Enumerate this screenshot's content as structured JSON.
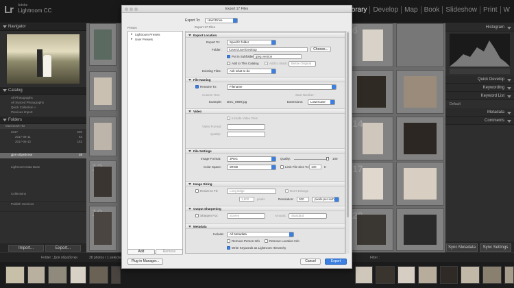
{
  "app": {
    "logo": "Lr",
    "vendor": "Adobe",
    "name": "Lightroom CC"
  },
  "modules": [
    "Library",
    "Develop",
    "Map",
    "Book",
    "Slideshow",
    "Print",
    "W"
  ],
  "left_panel": {
    "navigator": "Navigator",
    "catalog": "Catalog",
    "catalog_items": [
      "All Photographs",
      "All Synced Photographs",
      "Quick Collection +",
      "Previous Import"
    ],
    "folders": "Folders",
    "volume": "Macintosh HD",
    "folder_items": [
      {
        "label": "2017",
        "count": "230"
      },
      {
        "label": "2017-06-11",
        "count": "63"
      },
      {
        "label": "2017-06-12",
        "count": "162"
      }
    ],
    "selected_folder": {
      "label": "Для обработки",
      "count": "38"
    },
    "folder2": "Lightroom Data Base",
    "collections": [
      "Collections",
      "Publish Services"
    ],
    "import_btn": "Import...",
    "export_btn": "Export..."
  },
  "right_panel": {
    "histogram": "Histogram",
    "quick_develop": "Quick Develop",
    "keywording": "Keywording",
    "keyword_list": "Keyword List",
    "metadata": "Metadata",
    "comments": "Comments",
    "default": "Default",
    "sync_metadata": "Sync Metadata",
    "sync_settings": "Sync Settings"
  },
  "grid": {
    "numbers": [
      "6",
      "13",
      "14",
      "17",
      "19",
      "20"
    ]
  },
  "filmstrip": {
    "path": "Folder : Для обработки",
    "info": "38 photos / 1 selected / DSC_0999.jpg",
    "filter": "Filter :"
  },
  "dialog": {
    "title": "Export 17 Files",
    "export_to_label": "Export To:",
    "export_to_value": "Hard Drive",
    "subtitle": "Export 17 Files",
    "preset_header": "Preset:",
    "presets": [
      "Lightroom Presets",
      "User Presets"
    ],
    "add_btn": "Add",
    "remove_btn": "Remove",
    "sections": {
      "location": "Export Location",
      "naming": "File Naming",
      "video": "Video",
      "settings": "File Settings",
      "sizing": "Image Sizing",
      "sharpening": "Output Sharpening",
      "metadata": "Metadata"
    },
    "location": {
      "export_to": "Export To:",
      "export_to_value": "Specific folder",
      "folder": "Folder:",
      "folder_value": "/Users/user/Desktop",
      "choose": "Choose...",
      "subfolder": "Put in Subfolder:",
      "subfolder_value": "jpeg version",
      "add_catalog": "Add to This Catalog",
      "add_stack": "Add to Stack:",
      "below": "Below Original",
      "existing": "Existing Files:",
      "existing_value": "Ask what to do"
    },
    "naming": {
      "rename": "Rename To:",
      "rename_value": "Filename",
      "custom": "Custom Text:",
      "start": "Start Number:",
      "example_label": "Example:",
      "example": "DSC_0999.jpg",
      "extensions": "Extensions:",
      "ext_value": "Lowercase"
    },
    "video": {
      "include": "Include Video Files",
      "format": "Video Format:",
      "quality": "Quality:"
    },
    "settings": {
      "format": "Image Format:",
      "format_value": "JPEG",
      "quality": "Quality:",
      "quality_value": "100",
      "colorspace": "Color Space:",
      "colorspace_value": "sRGB",
      "limit": "Limit File Size To:",
      "limit_value": "100",
      "limit_unit": "K"
    },
    "sizing": {
      "resize": "Resize to Fit:",
      "resize_value": "Long Edge",
      "enlarge": "Don't Enlarge",
      "size_value": "1,800",
      "size_unit": "pixels",
      "resolution": "Resolution:",
      "resolution_value": "300",
      "res_unit": "pixels per inch"
    },
    "sharpening": {
      "sharpen": "Sharpen For:",
      "sharpen_value": "Screen",
      "amount": "Amount:",
      "amount_value": "Standard"
    },
    "metadata": {
      "include": "Include:",
      "include_value": "All Metadata",
      "remove_person": "Remove Person Info",
      "remove_location": "Remove Location Info",
      "keywords": "Write Keywords as Lightroom Hierarchy"
    },
    "plugin_btn": "Plug-in Manager...",
    "cancel_btn": "Cancel",
    "export_btn": "Export"
  },
  "colors": {
    "accent": "#3b7fe0",
    "panel": "#2e2e2e",
    "grid": "#6b6b6b"
  }
}
